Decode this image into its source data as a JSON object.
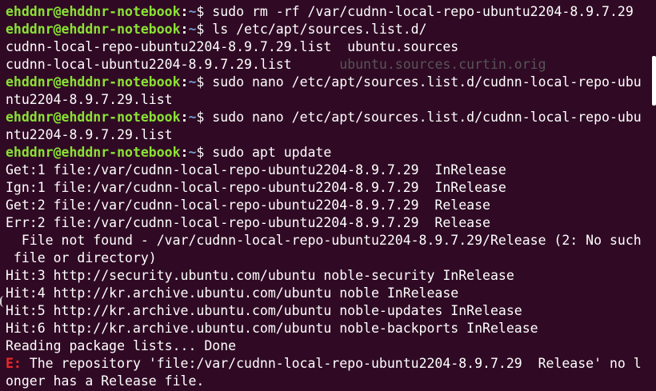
{
  "prompt": {
    "user_host": "ehddnr@ehddnr-notebook",
    "colon": ":",
    "path": "~",
    "dollar": "$"
  },
  "lines": [
    {
      "cmd": " sudo rm -rf /var/cudnn-local-repo-ubuntu2204-8.9.7.29"
    },
    {
      "cmd": " ls /etc/apt/sources.list.d/"
    },
    {
      "text": "cudnn-local-repo-ubuntu2204-8.9.7.29.list  ubuntu.sources"
    },
    {
      "text": "cudnn-local-ubuntu2204-8.9.7.29.list      ",
      "dim": "ubuntu.sources.curtin.orig"
    },
    {
      "cmd": " sudo nano /etc/apt/sources.list.d/cudnn-local-repo-ubu"
    },
    {
      "text": "ntu2204-8.9.7.29.list"
    },
    {
      "cmd": " sudo nano /etc/apt/sources.list.d/cudnn-local-repo-ubu"
    },
    {
      "text": "ntu2204-8.9.7.29.list"
    },
    {
      "cmd": " sudo apt update"
    },
    {
      "text": "Get:1 file:/var/cudnn-local-repo-ubuntu2204-8.9.7.29  InRelease"
    },
    {
      "text": "Ign:1 file:/var/cudnn-local-repo-ubuntu2204-8.9.7.29  InRelease"
    },
    {
      "text": "Get:2 file:/var/cudnn-local-repo-ubuntu2204-8.9.7.29  Release"
    },
    {
      "text": "Err:2 file:/var/cudnn-local-repo-ubuntu2204-8.9.7.29  Release"
    },
    {
      "text": "  File not found - /var/cudnn-local-repo-ubuntu2204-8.9.7.29/Release (2: No such"
    },
    {
      "text": " file or directory)"
    },
    {
      "text": "Hit:3 http://security.ubuntu.com/ubuntu noble-security InRelease"
    },
    {
      "text": "Hit:4 http://kr.archive.ubuntu.com/ubuntu noble InRelease"
    },
    {
      "text": "Hit:5 http://kr.archive.ubuntu.com/ubuntu noble-updates InRelease"
    },
    {
      "text": "Hit:6 http://kr.archive.ubuntu.com/ubuntu noble-backports InRelease"
    },
    {
      "text": "Reading package lists... Done"
    },
    {
      "err": "E:",
      "text": " The repository 'file:/var/cudnn-local-repo-ubuntu2204-8.9.7.29  Release' no l"
    },
    {
      "text": "onger has a Release file."
    }
  ],
  "colors": {
    "background": "#300a24",
    "prompt_user": "#8ae234",
    "prompt_path": "#729fcf",
    "error": "#ef2929",
    "dim_text": "#585558",
    "text": "#ffffff"
  }
}
